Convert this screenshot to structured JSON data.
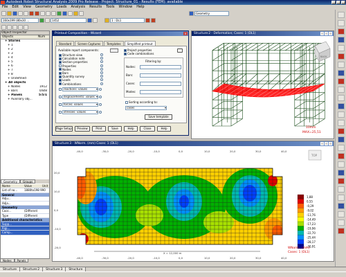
{
  "app": {
    "title": "Autodesk Robot Structural Analysis 2009 Pro Release - Project: Structure_01 - Results (FEM): available"
  },
  "menu": [
    "File",
    "Edit",
    "View",
    "Geometry",
    "Loads",
    "Analysis",
    "Results",
    "Tools",
    "Window",
    "Help"
  ],
  "toolbar": {
    "layout_combo": "Geometry",
    "section_combo": "160x199 (80x30 ...",
    "number_combo": "1452",
    "case_combo": "1 : DL1"
  },
  "inspector": {
    "title": "Object Inspector",
    "col_objects": "Objects",
    "col_num": "Num",
    "items": [
      {
        "label": "Stories",
        "num": "",
        "indent": 1,
        "bold": true
      },
      {
        "label": "1",
        "num": "",
        "indent": 2,
        "bold": false
      },
      {
        "label": "2",
        "num": "",
        "indent": 2,
        "bold": false
      },
      {
        "label": "3",
        "num": "",
        "indent": 2,
        "bold": false
      },
      {
        "label": "4",
        "num": "",
        "indent": 2,
        "bold": false
      },
      {
        "label": "5",
        "num": "",
        "indent": 2,
        "bold": false
      },
      {
        "label": "6",
        "num": "",
        "indent": 2,
        "bold": false
      },
      {
        "label": "7",
        "num": "",
        "indent": 2,
        "bold": false
      },
      {
        "label": "8",
        "num": "",
        "indent": 2,
        "bold": false
      },
      {
        "label": "Undefined",
        "num": "",
        "indent": 2,
        "bold": false
      },
      {
        "label": "All objects",
        "num": "",
        "indent": 1,
        "bold": true
      },
      {
        "label": "Nodes",
        "num": "1912",
        "indent": 2,
        "bold": false
      },
      {
        "label": "Bars",
        "num": "0/8/8",
        "indent": 2,
        "bold": false
      },
      {
        "label": "Panels",
        "num": "5/5/1",
        "indent": 2,
        "bold": true
      },
      {
        "label": "Auxiliary obj...",
        "num": "",
        "indent": 2,
        "bold": false
      }
    ],
    "tabs": [
      "Geometry",
      "Groups"
    ],
    "prop_header": {
      "name": "Name",
      "value": "Value",
      "unit": "Unit"
    },
    "props": [
      {
        "type": "row",
        "k": "List of no...",
        "v": "1880to198 990"
      },
      {
        "type": "group",
        "k": "General"
      },
      {
        "type": "row",
        "k": "Adju...",
        "v": ""
      },
      {
        "type": "row",
        "k": "Adja...",
        "v": ""
      },
      {
        "type": "group",
        "k": "Geometry"
      },
      {
        "type": "row",
        "k": "Coor...",
        "v": "(Different"
      },
      {
        "type": "row",
        "k": "Type",
        "v": "(Different"
      },
      {
        "type": "group",
        "k": "Additional characteristics"
      },
      {
        "type": "sel",
        "k": "Supp...",
        "v": ""
      },
      {
        "type": "sel",
        "k": "Rigi...",
        "v": ""
      },
      {
        "type": "sel",
        "k": "Comp...",
        "v": ""
      }
    ],
    "bottom_tabs": [
      "Nodes",
      "Panels"
    ]
  },
  "dialog": {
    "title": "Printout Composition - Wizard",
    "tabs": [
      "Standard",
      "Screen Captures",
      "Templates",
      "Simplified printout"
    ],
    "available_label": "Available report components:",
    "left_items": [
      {
        "label": "Structure view",
        "checked": true
      },
      {
        "label": "Calculation note",
        "checked": true
      },
      {
        "label": "Section properties",
        "checked": true
      },
      {
        "label": "Properties",
        "checked": false
      },
      {
        "label": "Nodes",
        "checked": true
      },
      {
        "label": "Bars",
        "checked": true
      },
      {
        "label": "Quantity survey",
        "checked": true
      },
      {
        "label": "Loads",
        "checked": true
      },
      {
        "label": "Combinations",
        "checked": true
      }
    ],
    "select_rows": [
      {
        "label": "reactions: values"
      },
      {
        "label": "displacements: values"
      },
      {
        "label": "forces: values"
      },
      {
        "label": "stresses: values"
      }
    ],
    "right_items": [
      {
        "label": "Project properties",
        "checked": true
      },
      {
        "label": "Code combinations",
        "checked": true
      }
    ],
    "filtering_label": "Filtering by:",
    "filters": [
      "Nodes:",
      "Bars:",
      "Cases:",
      "Modes:"
    ],
    "sorting_label": "Sorting according to:",
    "sorting_value": "cases",
    "save_template": "Save template",
    "buttons": [
      "Page Setup",
      "Preview",
      "Print",
      "Save",
      "Help",
      "Close",
      "Help"
    ]
  },
  "view1": {
    "title": "Structure:2 - Deformation; Cases: 1 (DL1)",
    "cube_label": "BACK",
    "legend_line1": "10mm",
    "legend_line2": "MAX=25,51",
    "colors": {
      "frame": "#1b4d1b",
      "deform": "#ff0000"
    }
  },
  "view2": {
    "title": "Structure:3 - WNorm. (mm) Cases: 1 (DL1)",
    "top_label": "TOP",
    "axis_top": [
      "-40,0",
      "-30,0",
      "-20,0",
      "-10,0",
      "0,0",
      "10,0",
      "20,0",
      "30,0",
      "40,0"
    ],
    "axis_bottom": [
      "-40,0",
      "-30,0",
      "-20,0",
      "-10,0",
      "0,0",
      "10,0",
      "20,0",
      "30,0",
      "40,0"
    ],
    "axis_left": [
      "20,0",
      "10,0",
      "0,0",
      "-10,0",
      "-20,0"
    ],
    "dimension": "X = 12,000 m",
    "legend_values": [
      "1,88",
      "0,55",
      "-0,29",
      "-9,02",
      "-11,76",
      "-14,49",
      "-17,23",
      "-19,96",
      "-22,70",
      "-25,44",
      "-28,17",
      "-30,91"
    ],
    "legend_colors": [
      "#8b0000",
      "#e00000",
      "#ff5a00",
      "#ff9a00",
      "#ffd000",
      "#f6ff00",
      "#a8e000",
      "#00b000",
      "#00b8b0",
      "#0090ff",
      "#0040ff",
      "#00008b"
    ],
    "result_line1": "WNorm., (mm)",
    "result_line2": "Cases: 1 (DL1)"
  },
  "bottom_tabs": [
    "Structure",
    "Structure:2",
    "Structure:3",
    "Structure"
  ]
}
